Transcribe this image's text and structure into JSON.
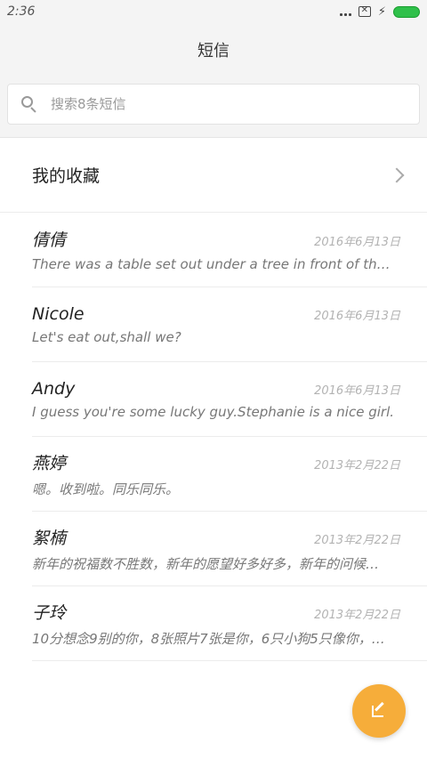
{
  "status_bar": {
    "time": "2:36"
  },
  "header": {
    "title": "短信"
  },
  "search": {
    "placeholder": "搜索8条短信"
  },
  "favorites": {
    "label": "我的收藏"
  },
  "conversations": [
    {
      "name": "倩倩",
      "date": "2016年6月13日",
      "preview": "There was a table set out under a tree in front of the hous"
    },
    {
      "name": "Nicole",
      "date": "2016年6月13日",
      "preview": "Let's eat out,shall we?"
    },
    {
      "name": "Andy",
      "date": "2016年6月13日",
      "preview": "I guess you're some lucky guy.Stephanie is a nice girl."
    },
    {
      "name": "燕婷",
      "date": "2013年2月22日",
      "preview": "嗯。收到啦。同乐同乐。"
    },
    {
      "name": "絮楠",
      "date": "2013年2月22日",
      "preview": "新年的祝福数不胜数，新年的愿望好多好多，新年的问候…"
    },
    {
      "name": "子玲",
      "date": "2013年2月22日",
      "preview": "10分想念9别的你，8张照片7张是你，6只小狗5只像你，…"
    }
  ],
  "colors": {
    "accent": "#f6ad3a",
    "battery": "#2fc04a"
  },
  "icons": {
    "search": "search-icon",
    "chevron": "chevron-right-icon",
    "compose": "compose-icon"
  }
}
